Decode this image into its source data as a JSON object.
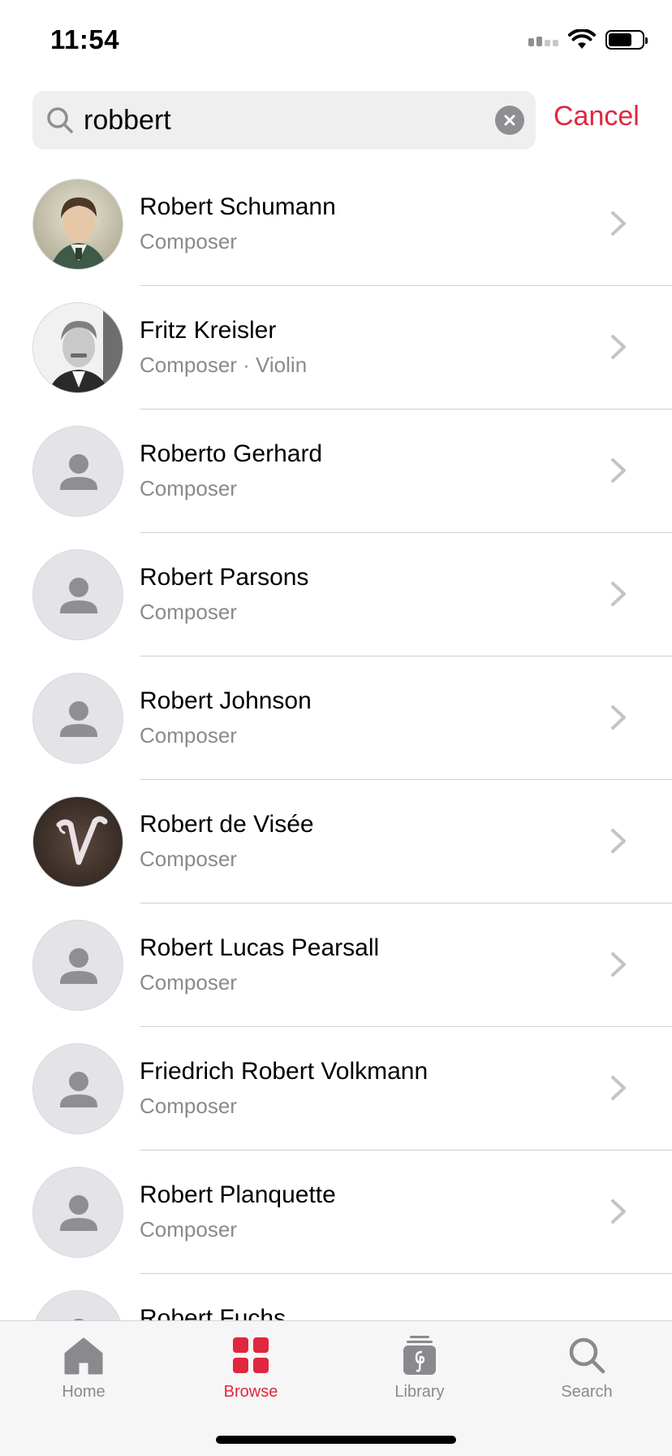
{
  "status_bar": {
    "time": "11:54"
  },
  "search": {
    "value": "robbert",
    "cancel_label": "Cancel"
  },
  "results": [
    {
      "name": "Robert Schumann",
      "role": "Composer",
      "avatar": "portrait-schumann"
    },
    {
      "name": "Fritz Kreisler",
      "role": "Composer · Violin",
      "avatar": "portrait-kreisler"
    },
    {
      "name": "Roberto Gerhard",
      "role": "Composer",
      "avatar": "placeholder"
    },
    {
      "name": "Robert Parsons",
      "role": "Composer",
      "avatar": "placeholder"
    },
    {
      "name": "Robert Johnson",
      "role": "Composer",
      "avatar": "placeholder"
    },
    {
      "name": "Robert de Visée",
      "role": "Composer",
      "avatar": "monogram-v"
    },
    {
      "name": "Robert Lucas Pearsall",
      "role": "Composer",
      "avatar": "placeholder"
    },
    {
      "name": "Friedrich Robert Volkmann",
      "role": "Composer",
      "avatar": "placeholder"
    },
    {
      "name": "Robert Planquette",
      "role": "Composer",
      "avatar": "placeholder"
    },
    {
      "name": "Robert Fuchs",
      "role": "",
      "avatar": "placeholder"
    }
  ],
  "tab_bar": {
    "tabs": [
      {
        "label": "Home",
        "icon": "home-icon",
        "active": false
      },
      {
        "label": "Browse",
        "icon": "browse-grid-icon",
        "active": true
      },
      {
        "label": "Library",
        "icon": "library-icon",
        "active": false
      },
      {
        "label": "Search",
        "icon": "search-icon",
        "active": false
      }
    ]
  },
  "colors": {
    "accent": "#e0273f",
    "secondary_text": "#8a8a8e",
    "separator": "#d1d1d6"
  }
}
